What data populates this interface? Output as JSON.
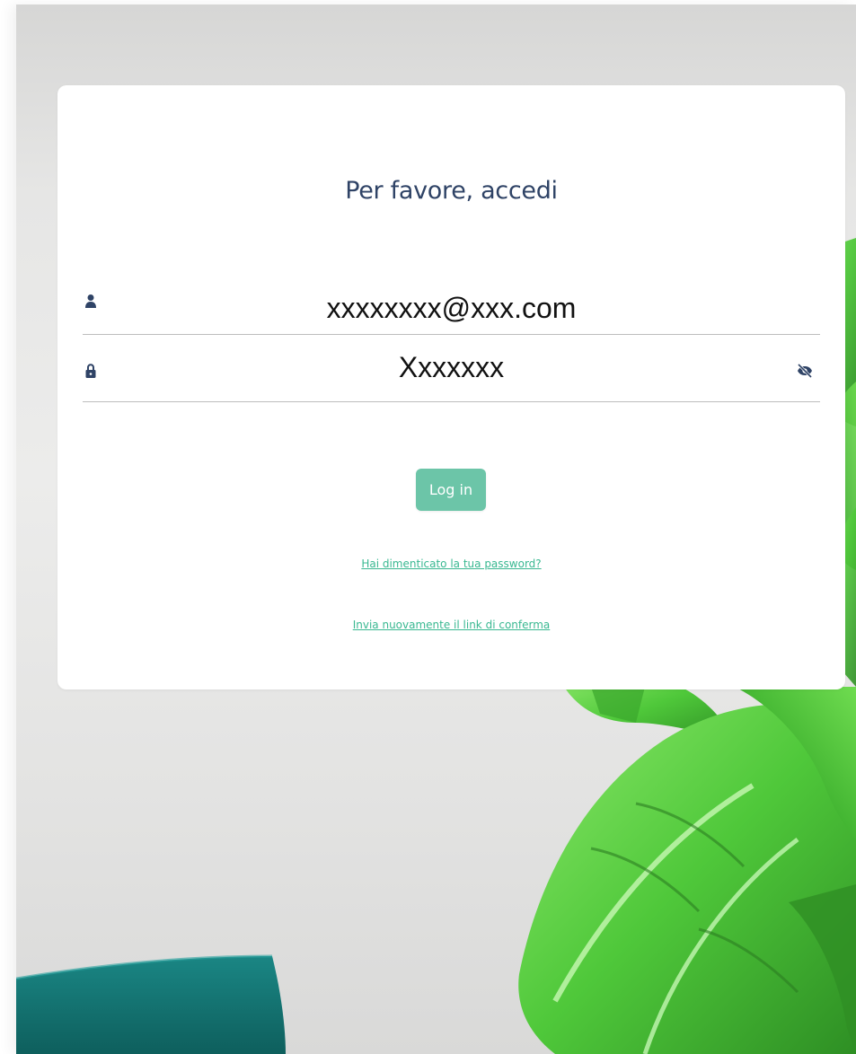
{
  "login": {
    "title": "Per favore, accedi",
    "email_value": "xxxxxxxx@xxx.com",
    "password_value": "Xxxxxxx",
    "submit_label": "Log in",
    "forgot_password_link": "Hai dimenticato la tua password?",
    "resend_confirmation_link": "Invia nuovamente il link di conferma"
  },
  "icons": {
    "email_field": "user-icon",
    "password_field": "lock-icon",
    "password_toggle": "eye-slash-icon"
  },
  "colors": {
    "title_text": "#2f4366",
    "icon": "#2f4366",
    "accent_button": "#6cc5a8",
    "link": "#39b891",
    "divider": "#bdbdbd",
    "card_background": "#ffffff",
    "page_background": "#e6e6e5",
    "cushion": "#157a78",
    "leaf": "#4ec83a"
  }
}
